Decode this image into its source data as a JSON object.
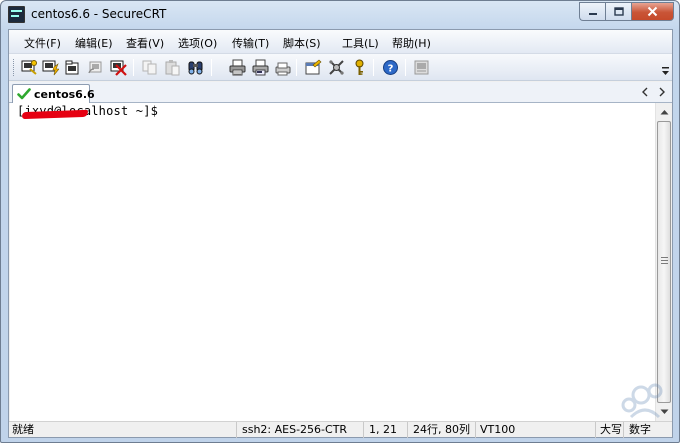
{
  "window": {
    "title": "centos6.6 - SecureCRT",
    "controls": {
      "minimize": "–",
      "maximize": "□",
      "close": "✕"
    }
  },
  "menu": {
    "items": [
      "文件(F)",
      "编辑(E)",
      "查看(V)",
      "选项(O)",
      "传输(T)",
      "脚本(S)",
      "工具(L)",
      "帮助(H)"
    ]
  },
  "toolbar": {
    "buttons": [
      "connect-icon",
      "quick-connect-icon",
      "connect-in-tab-icon",
      "reconnect-icon",
      "disconnect-icon",
      "copy-icon",
      "paste-icon",
      "find-icon",
      "print-icon",
      "print-selection-icon",
      "print-setup-icon",
      "session-options-icon",
      "global-options-icon",
      "keymap-icon",
      "help-icon",
      "sftp-icon"
    ]
  },
  "tabs": [
    {
      "label": "centos6.6",
      "status": "connected",
      "icon": "check-icon"
    }
  ],
  "terminal": {
    "line1": "[jxyd@localhost ~]$"
  },
  "statusbar": {
    "status": "就绪",
    "protocol": "ssh2: AES-256-CTR",
    "cursor": "1,  21",
    "size": "24行, 80列",
    "emulation": "VT100",
    "caps": "大写",
    "num": "数字"
  },
  "colors": {
    "redaction": "#e60012",
    "tab_check": "#2fa82f",
    "close_button": "#c64a2b"
  }
}
